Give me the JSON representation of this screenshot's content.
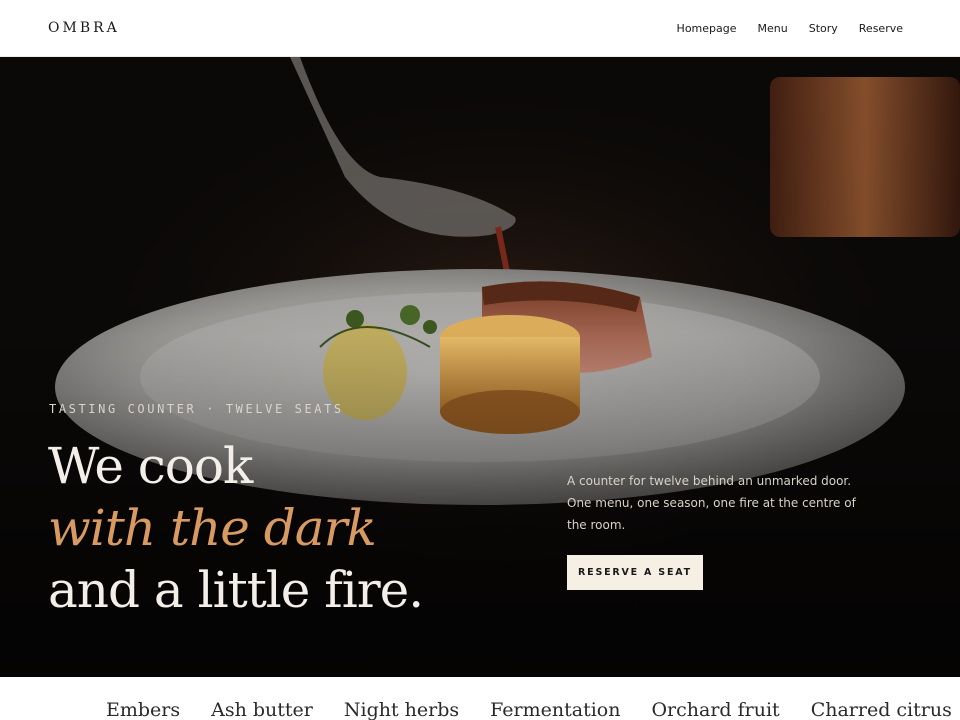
{
  "header": {
    "logo": "OMBRA",
    "nav": [
      {
        "label": "Homepage"
      },
      {
        "label": "Menu"
      },
      {
        "label": "Story"
      },
      {
        "label": "Reserve"
      }
    ]
  },
  "hero": {
    "eyebrow": "TASTING COUNTER · TWELVE SEATS",
    "headline_line1": "We cook",
    "headline_line2": "with the dark",
    "headline_line3": "and a little fire.",
    "blurb": "A counter for twelve behind an unmarked door. One menu, one season, one fire at the centre of the room.",
    "cta_label": "RESERVE A SEAT"
  },
  "ticker": {
    "items": [
      "Embers",
      "Ash butter",
      "Night herbs",
      "Fermentation",
      "Orchard fruit",
      "Charred citrus"
    ]
  },
  "colors": {
    "accent": "#d99a62",
    "cta_bg": "#f6efe4",
    "hero_bg": "#0a0807"
  }
}
